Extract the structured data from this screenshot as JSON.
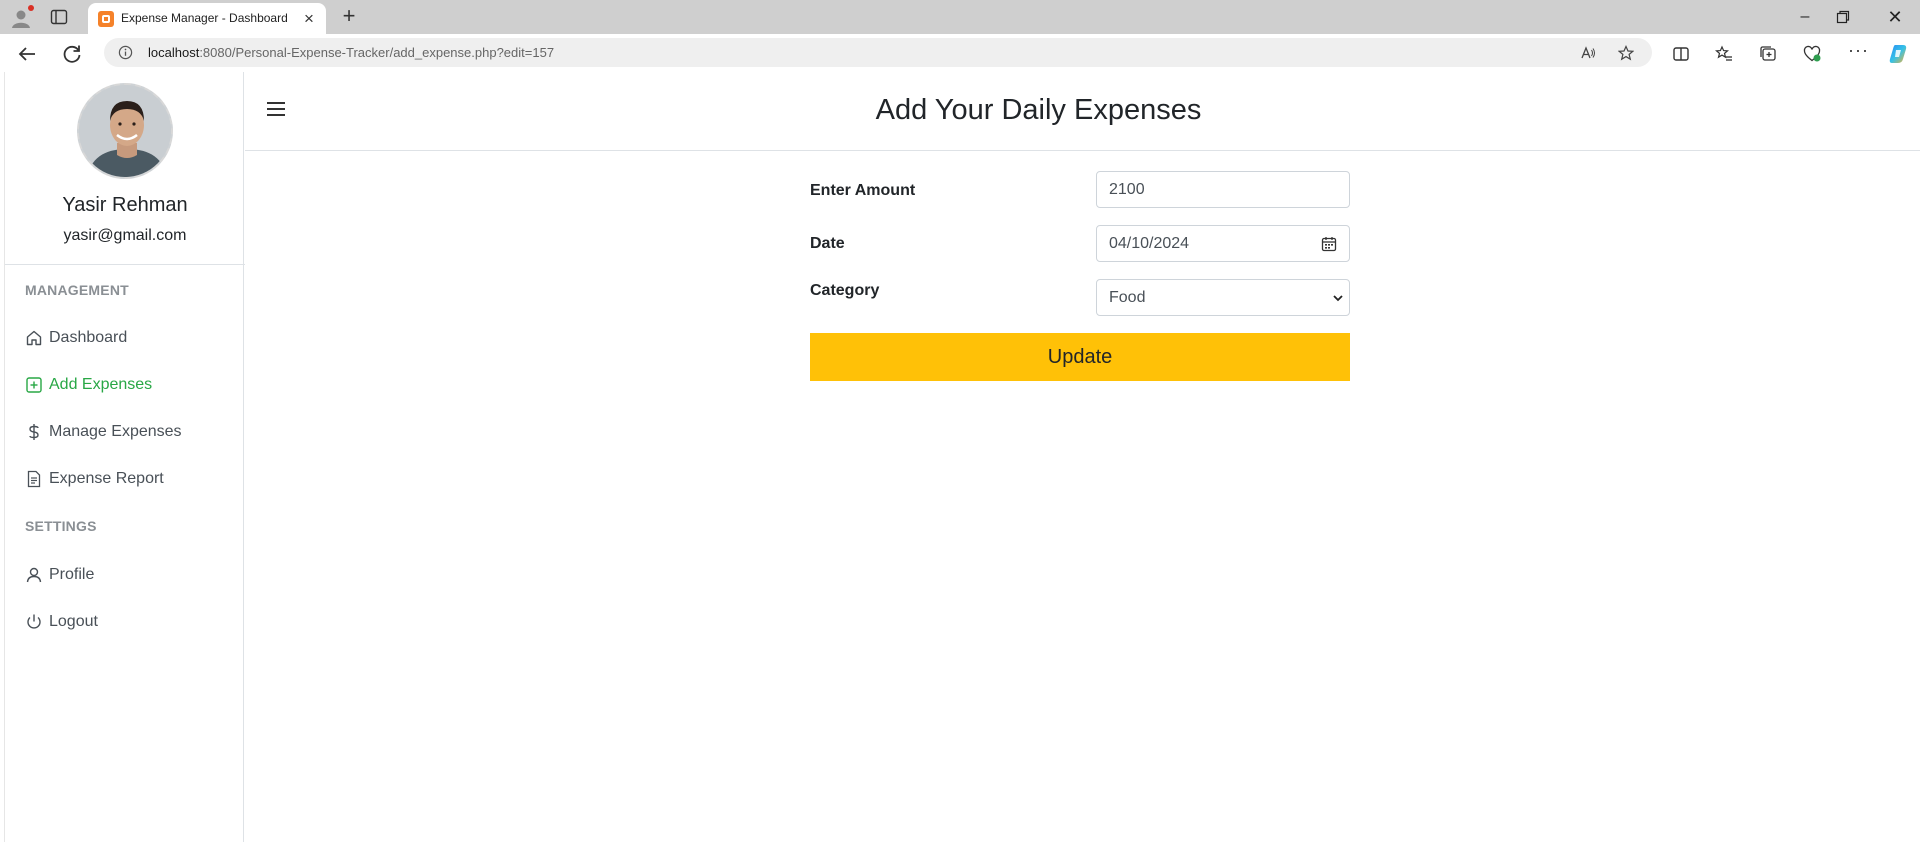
{
  "browser": {
    "tab_title": "Expense Manager - Dashboard",
    "url_host": "localhost",
    "url_rest": ":8080/Personal-Expense-Tracker/add_expense.php?edit=157",
    "icons": [
      "profile-icon",
      "tabs-icon",
      "close-icon",
      "plus-icon",
      "minimize-icon",
      "restore-icon",
      "close-window-icon",
      "back-icon",
      "refresh-icon",
      "info-icon",
      "read-aloud-icon",
      "favorite-star-icon",
      "split-screen-icon",
      "favorites-icon",
      "collections-icon",
      "browser-essentials-icon",
      "more-icon",
      "copilot-icon"
    ]
  },
  "sidebar": {
    "user_name": "Yasir Rehman",
    "user_email": "yasir@gmail.com",
    "sections": {
      "management": "MANAGEMENT",
      "settings": "SETTINGS"
    },
    "items": [
      {
        "label": "Dashboard",
        "icon": "house-icon"
      },
      {
        "label": "Add Expenses",
        "icon": "plus-square-icon",
        "active": true
      },
      {
        "label": "Manage Expenses",
        "icon": "dollar-icon"
      },
      {
        "label": "Expense Report",
        "icon": "document-icon"
      },
      {
        "label": "Profile",
        "icon": "person-icon"
      },
      {
        "label": "Logout",
        "icon": "power-icon"
      }
    ],
    "active_color": "#28a745"
  },
  "main": {
    "title": "Add Your Daily Expenses",
    "form": {
      "amount_label": "Enter Amount",
      "amount_value": "2100",
      "date_label": "Date",
      "date_value": "04/10/2024",
      "category_label": "Category",
      "category_value": "Food",
      "submit_label": "Update"
    },
    "button_color": "#ffc107"
  }
}
